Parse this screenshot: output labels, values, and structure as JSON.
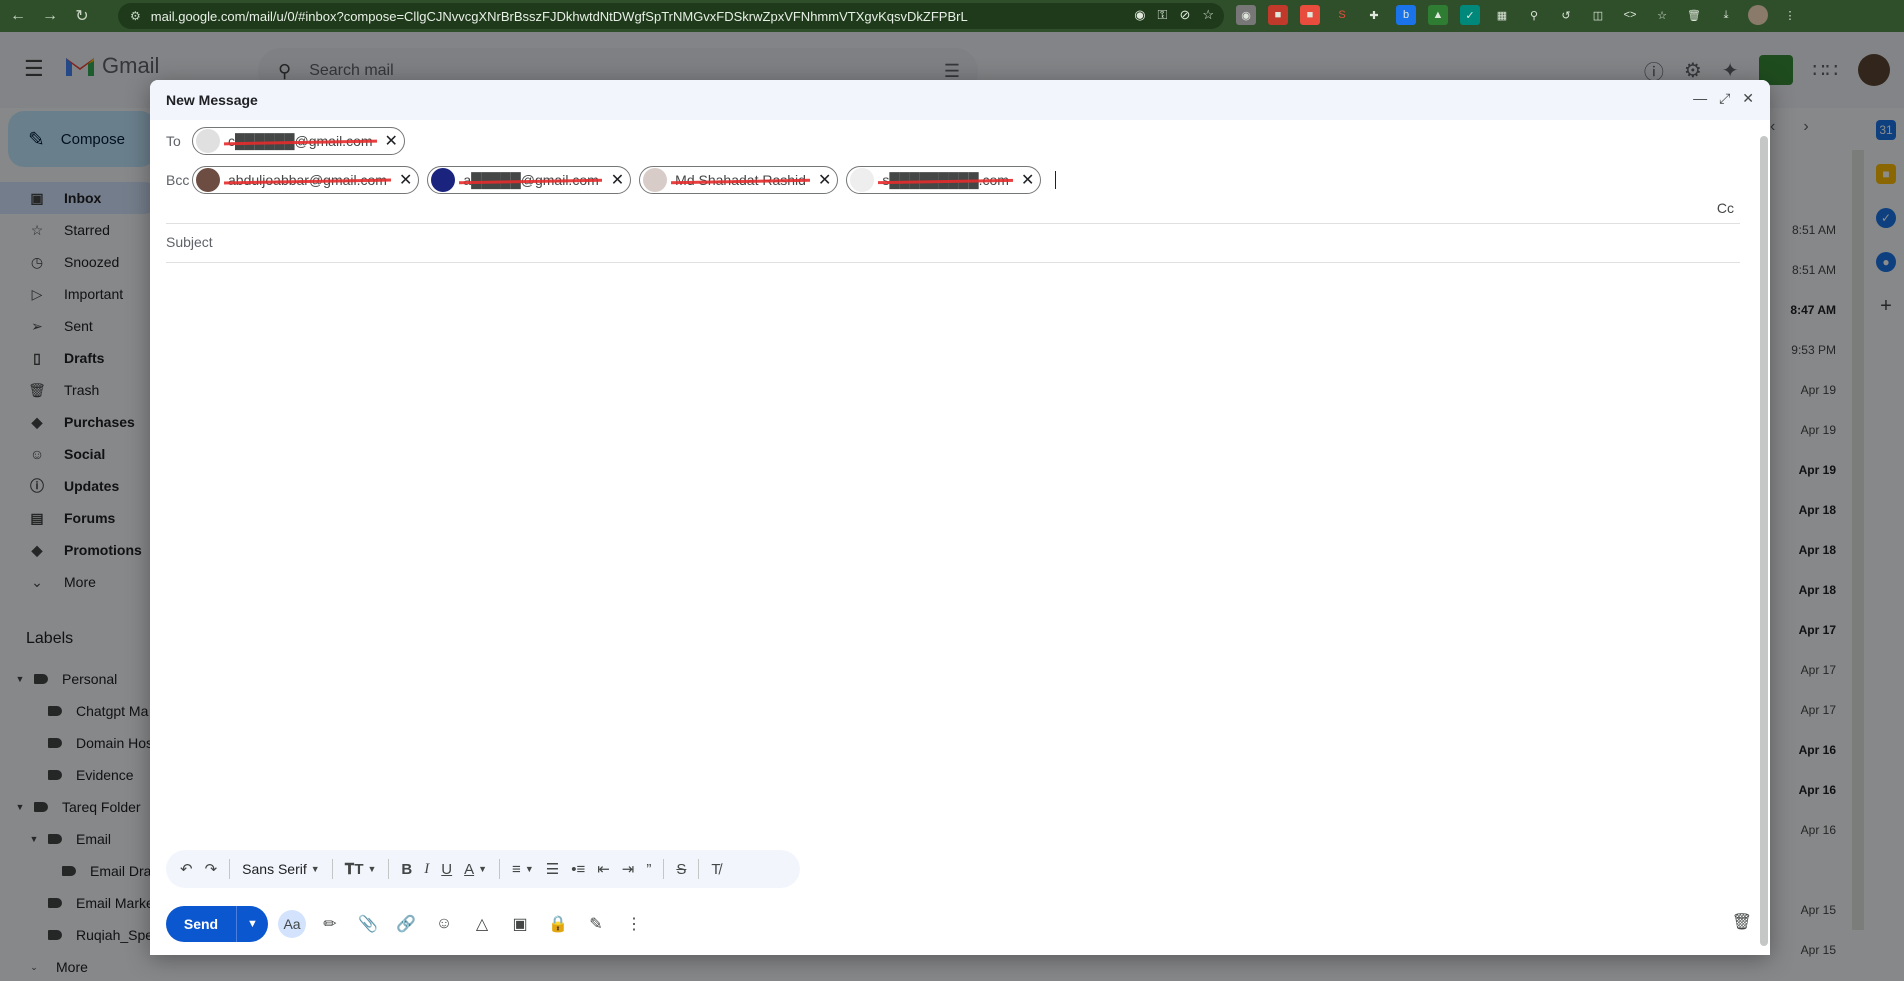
{
  "browser": {
    "url": "mail.google.com/mail/u/0/#inbox?compose=CllgCJNvvcgXNrBrBsszFJDkhwtdNtDWgfSpTrNMGvxFDSkrwZpxVFNhmmVTXgvKqsvDkZFPBrL"
  },
  "header": {
    "app_name": "Gmail",
    "search_placeholder": "Search mail"
  },
  "sidebar": {
    "compose_label": "Compose",
    "items": [
      {
        "label": "Inbox",
        "icon": "inbox-icon",
        "active": true
      },
      {
        "label": "Starred",
        "icon": "star-icon"
      },
      {
        "label": "Snoozed",
        "icon": "clock-icon"
      },
      {
        "label": "Important",
        "icon": "important-icon"
      },
      {
        "label": "Sent",
        "icon": "send-icon"
      },
      {
        "label": "Drafts",
        "icon": "draft-icon",
        "bold": true
      },
      {
        "label": "Trash",
        "icon": "trash-icon"
      },
      {
        "label": "Purchases",
        "icon": "tag-icon",
        "bold": true
      },
      {
        "label": "Social",
        "icon": "people-icon",
        "bold": true
      },
      {
        "label": "Updates",
        "icon": "info-icon",
        "bold": true
      },
      {
        "label": "Forums",
        "icon": "forum-icon",
        "bold": true
      },
      {
        "label": "Promotions",
        "icon": "tag-icon",
        "bold": true
      },
      {
        "label": "More",
        "icon": "chevron-down-icon"
      }
    ],
    "labels_title": "Labels",
    "labels": [
      {
        "label": "Personal",
        "indent": 0,
        "expanded": true
      },
      {
        "label": "Chatgpt Ma",
        "indent": 1
      },
      {
        "label": "Domain Hos",
        "indent": 1
      },
      {
        "label": "Evidence",
        "indent": 1
      },
      {
        "label": "Tareq Folder",
        "indent": 0,
        "expanded": true
      },
      {
        "label": "Email",
        "indent": 1,
        "expanded": true
      },
      {
        "label": "Email Dra",
        "indent": 2
      },
      {
        "label": "Email Marke",
        "indent": 1
      },
      {
        "label": "Ruqiah_Spe",
        "indent": 1
      },
      {
        "label": "More",
        "indent": 0
      }
    ]
  },
  "mail_list": {
    "dates": [
      {
        "text": "8:51 AM",
        "bold": false
      },
      {
        "text": "8:51 AM",
        "bold": false
      },
      {
        "text": "8:47 AM",
        "bold": true
      },
      {
        "text": "9:53 PM",
        "bold": false
      },
      {
        "text": "Apr 19",
        "bold": false
      },
      {
        "text": "Apr 19",
        "bold": false
      },
      {
        "text": "Apr 19",
        "bold": true
      },
      {
        "text": "Apr 18",
        "bold": true
      },
      {
        "text": "Apr 18",
        "bold": true
      },
      {
        "text": "Apr 18",
        "bold": true
      },
      {
        "text": "Apr 17",
        "bold": true
      },
      {
        "text": "Apr 17",
        "bold": false
      },
      {
        "text": "Apr 17",
        "bold": false
      },
      {
        "text": "Apr 16",
        "bold": true
      },
      {
        "text": "Apr 16",
        "bold": true
      },
      {
        "text": "Apr 16",
        "bold": false
      },
      {
        "text": "",
        "bold": false
      },
      {
        "text": "Apr 15",
        "bold": false
      },
      {
        "text": "Apr 15",
        "bold": false
      }
    ]
  },
  "compose": {
    "title": "New Message",
    "to_label": "To",
    "bcc_label": "Bcc",
    "cc_label": "Cc",
    "to_chips": [
      {
        "text": "c██████@gmail.com"
      }
    ],
    "bcc_chips": [
      {
        "text": "abduljoabbar@gmail.com"
      },
      {
        "text": "a█████@gmail.com"
      },
      {
        "text": "Md Shahadat Rashid"
      },
      {
        "text": "s█████████.com"
      }
    ],
    "subject_placeholder": "Subject",
    "font_name": "Sans Serif",
    "send_label": "Send"
  },
  "colors": {
    "accent": "#0b57d0",
    "chrome": "#2f4f2a",
    "redaction": "#e52b2b"
  }
}
